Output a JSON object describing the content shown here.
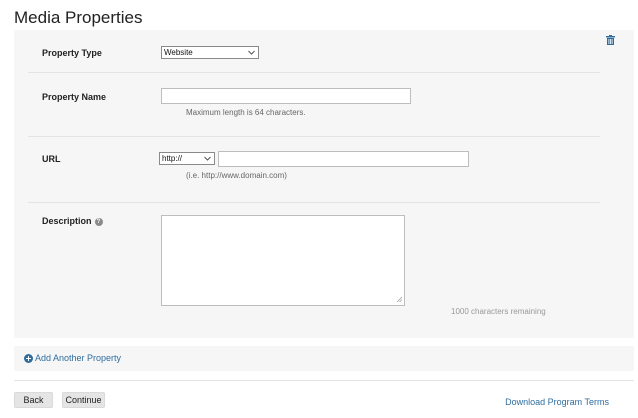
{
  "page": {
    "title": "Media Properties"
  },
  "form": {
    "property_type": {
      "label": "Property Type",
      "value": "Website"
    },
    "property_name": {
      "label": "Property Name",
      "value": "",
      "hint": "Maximum length is 64 characters."
    },
    "url": {
      "label": "URL",
      "protocol": "http://",
      "value": "",
      "hint": "(i.e. http://www.domain.com)"
    },
    "description": {
      "label": "Description",
      "help": "?",
      "value": "",
      "remaining": "1000 characters remaining"
    }
  },
  "actions": {
    "add_property": "Add Another Property",
    "back": "Back",
    "continue": "Continue",
    "terms": "Download Program Terms"
  },
  "icons": {
    "delete": "trash-icon",
    "add": "plus-circle-icon",
    "help": "help-icon",
    "dropdown": "chevron-down-icon"
  },
  "colors": {
    "link": "#2f6d9f",
    "panel": "#f6f6f6"
  }
}
